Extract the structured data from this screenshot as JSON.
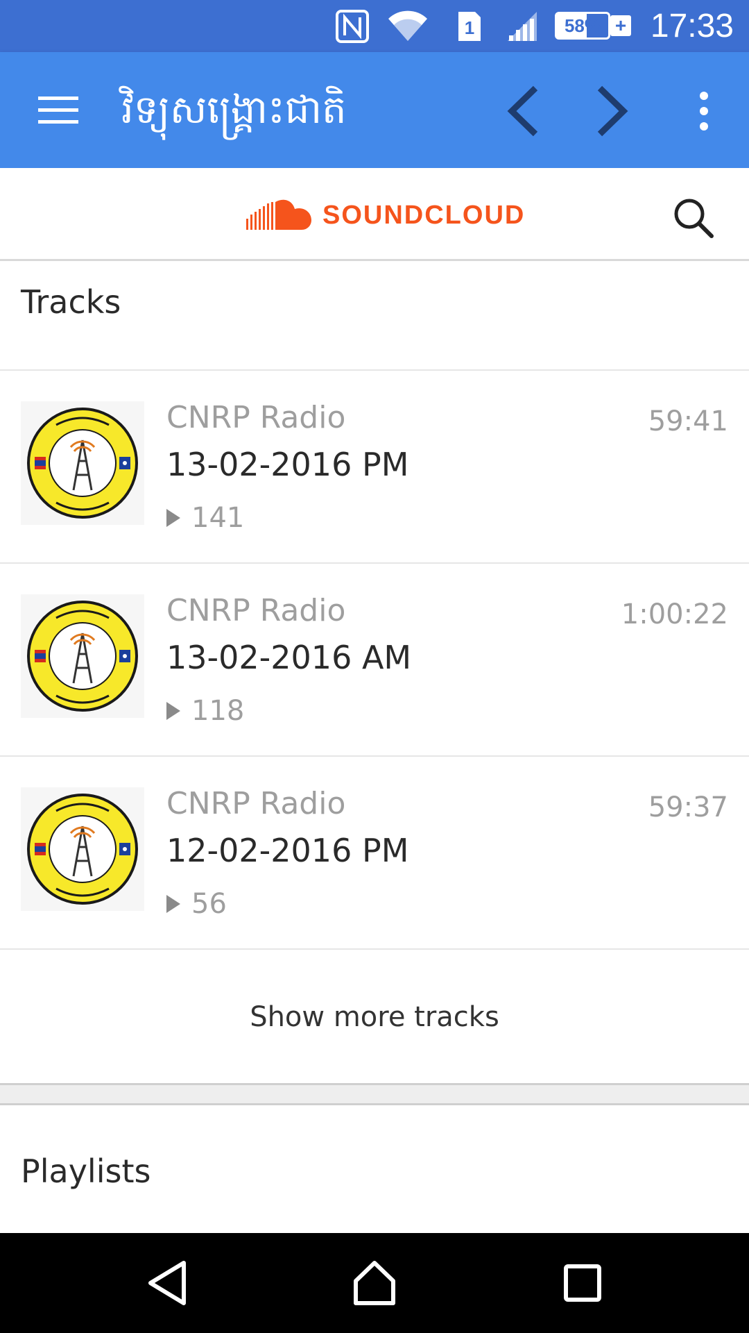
{
  "status_bar": {
    "time": "17:33",
    "battery_percent": "58%",
    "battery_level": 0.58,
    "sim_slot": "1",
    "icons": [
      "nfc-icon",
      "wifi-icon",
      "sim-icon",
      "signal-icon",
      "battery-icon",
      "charging-icon"
    ]
  },
  "app_bar": {
    "title": "វិទ្យុសង្គ្រោះជាតិ",
    "color": "#4389ea",
    "icons": [
      "menu-icon",
      "back-icon",
      "forward-icon",
      "overflow-menu-icon"
    ]
  },
  "soundcloud": {
    "logo_text": "SOUNDCLOUD",
    "brand_color": "#f5541c",
    "search_icon": "search-icon"
  },
  "tracks_section": {
    "title": "Tracks",
    "items": [
      {
        "user": "CNRP Radio",
        "title": "13-02-2016 PM",
        "duration": "59:41",
        "plays": "141"
      },
      {
        "user": "CNRP Radio",
        "title": "13-02-2016 AM",
        "duration": "1:00:22",
        "plays": "118"
      },
      {
        "user": "CNRP Radio",
        "title": "12-02-2016 PM",
        "duration": "59:37",
        "plays": "56"
      }
    ],
    "show_more_label": "Show more tracks"
  },
  "playlists_section": {
    "title": "Playlists"
  },
  "nav_bar": {
    "icons": [
      "nav-back-icon",
      "nav-home-icon",
      "nav-recents-icon"
    ]
  }
}
